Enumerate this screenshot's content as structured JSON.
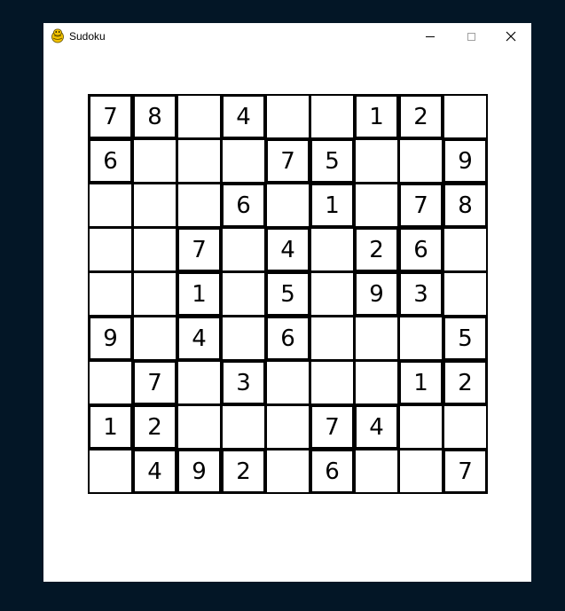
{
  "window": {
    "title": "Sudoku",
    "icon": "pygame-snake-icon",
    "controls": {
      "minimize": "minimize-icon",
      "maximize": "maximize-icon",
      "close": "close-icon"
    }
  },
  "board": {
    "rows": [
      [
        "7",
        "8",
        "",
        "4",
        "",
        "",
        "1",
        "2",
        ""
      ],
      [
        "6",
        "",
        "",
        "",
        "7",
        "5",
        "",
        "",
        "9"
      ],
      [
        "",
        "",
        "",
        "6",
        "",
        "1",
        "",
        "7",
        "8"
      ],
      [
        "",
        "",
        "7",
        "",
        "4",
        "",
        "2",
        "6",
        ""
      ],
      [
        "",
        "",
        "1",
        "",
        "5",
        "",
        "9",
        "3",
        ""
      ],
      [
        "9",
        "",
        "4",
        "",
        "6",
        "",
        "",
        "",
        "5"
      ],
      [
        "",
        "7",
        "",
        "3",
        "",
        "",
        "",
        "1",
        "2"
      ],
      [
        "1",
        "2",
        "",
        "",
        "",
        "7",
        "4",
        "",
        ""
      ],
      [
        "",
        "4",
        "9",
        "2",
        "",
        "6",
        "",
        "",
        "7"
      ]
    ]
  },
  "colors": {
    "desktop": "#031626",
    "window": "#ffffff",
    "grid": "#000000"
  }
}
